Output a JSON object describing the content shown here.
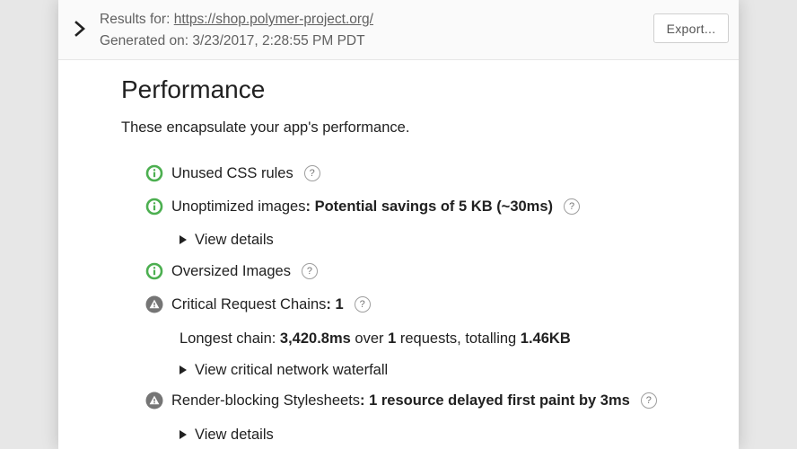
{
  "header": {
    "results_label": "Results for: ",
    "results_url": "https://shop.polymer-project.org/",
    "generated_label": "Generated on: ",
    "generated_value": "3/23/2017, 2:28:55 PM PDT",
    "export_label": "Export..."
  },
  "section": {
    "title": "Performance",
    "description": "These encapsulate your app's performance."
  },
  "audits": [
    {
      "label": "Unused CSS rules",
      "value": "",
      "status": "pass",
      "help": "?"
    },
    {
      "label": "Unoptimized images",
      "value": ": Potential savings of 5 KB (~30ms)",
      "status": "pass",
      "help": "?",
      "details_label": "View details"
    },
    {
      "label": "Oversized Images",
      "value": "",
      "status": "pass",
      "help": "?"
    },
    {
      "label": "Critical Request Chains",
      "value": ": 1",
      "status": "warn",
      "help": "?",
      "chain": {
        "prefix": "Longest chain: ",
        "duration": "3,420.8ms",
        "over": " over ",
        "count": "1",
        "requests": " requests, totalling ",
        "size": "1.46KB"
      },
      "details_label": "View critical network waterfall"
    },
    {
      "label": "Render-blocking Stylesheets",
      "value": ": 1 resource delayed first paint by 3ms",
      "status": "warn",
      "help": "?",
      "details_label": "View details"
    }
  ],
  "colors": {
    "pass": "#4caf50",
    "warn": "#757575"
  },
  "icons": {
    "expand": "chevron-right-icon",
    "pass": "info-circle-icon",
    "warn": "warning-triangle-icon",
    "help": "help-circle-icon",
    "disclosure": "disclosure-triangle-icon"
  }
}
